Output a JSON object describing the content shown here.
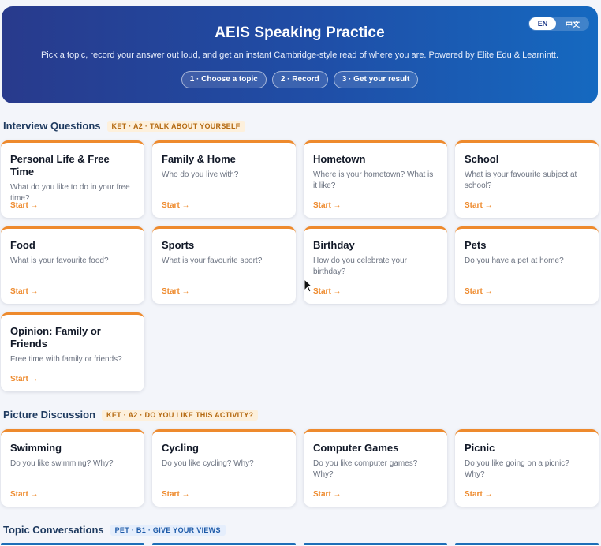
{
  "hero": {
    "title": "AEIS Speaking Practice",
    "subtitle": "Pick a topic, record your answer out loud, and get an instant Cambridge-style read of where you are. Powered by Elite Edu & Learnintt.",
    "steps": [
      "1 · Choose a topic",
      "2 · Record",
      "3 · Get your result"
    ],
    "lang_en": "EN",
    "lang_zh": "中文"
  },
  "sections": [
    {
      "title": "Interview Questions",
      "tag": "KET · A2 · TALK ABOUT YOURSELF",
      "cards": [
        {
          "title": "Personal Life & Free Time",
          "desc": "What do you like to do in your free time?",
          "start": "Start →"
        },
        {
          "title": "Family & Home",
          "desc": "Who do you live with?",
          "start": "Start →"
        },
        {
          "title": "Hometown",
          "desc": "Where is your hometown? What is it like?",
          "start": "Start →"
        },
        {
          "title": "School",
          "desc": "What is your favourite subject at school?",
          "start": "Start →"
        },
        {
          "title": "Food",
          "desc": "What is your favourite food?",
          "start": "Start →"
        },
        {
          "title": "Sports",
          "desc": "What is your favourite sport?",
          "start": "Start →"
        },
        {
          "title": "Birthday",
          "desc": "How do you celebrate your birthday?",
          "start": "Start →"
        },
        {
          "title": "Pets",
          "desc": "Do you have a pet at home?",
          "start": "Start →"
        },
        {
          "title": "Opinion: Family or Friends",
          "desc": "Free time with family or friends?",
          "start": "Start →"
        }
      ]
    },
    {
      "title": "Picture Discussion",
      "tag": "KET · A2 · DO YOU LIKE THIS ACTIVITY?",
      "cards": [
        {
          "title": "Swimming",
          "desc": "Do you like swimming? Why?",
          "start": "Start →"
        },
        {
          "title": "Cycling",
          "desc": "Do you like cycling? Why?",
          "start": "Start →"
        },
        {
          "title": "Computer Games",
          "desc": "Do you like computer games? Why?",
          "start": "Start →"
        },
        {
          "title": "Picnic",
          "desc": "Do you like going on a picnic? Why?",
          "start": "Start →"
        }
      ]
    },
    {
      "title": "Topic Conversations",
      "tag": "PET · B1 · GIVE YOUR VIEWS"
    }
  ],
  "colors": {
    "accent": "#ee8a2d",
    "hero_start": "#283a8c",
    "hero_end": "#1569c0",
    "pet_blue": "#1d6fb8"
  }
}
